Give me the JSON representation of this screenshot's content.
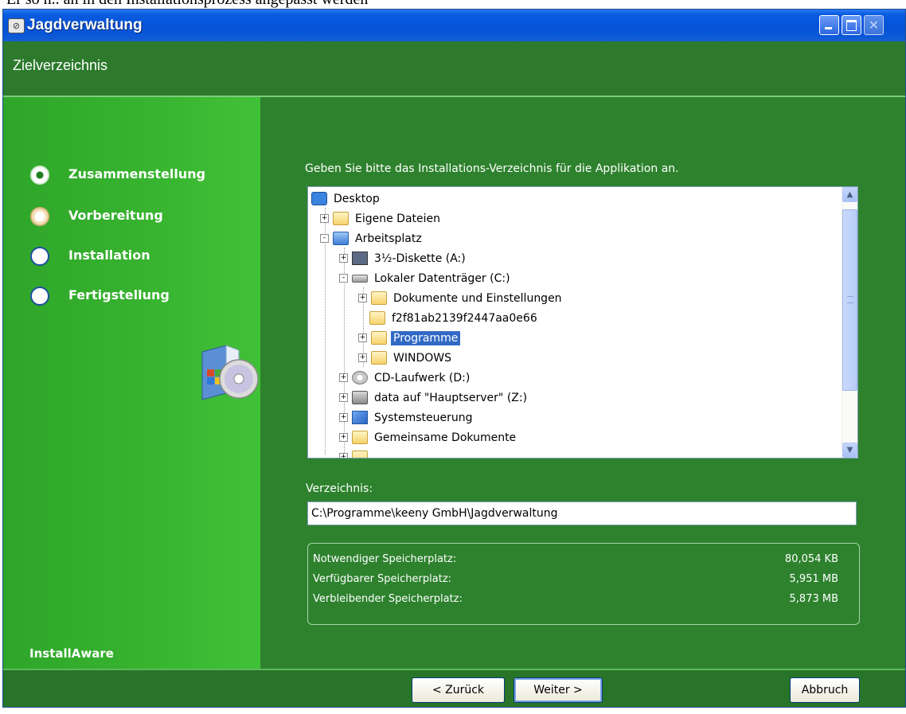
{
  "clipped_text": "Er so h.. an in den Installationsprozess angepasst werden",
  "window": {
    "title": "Jagdverwaltung",
    "buttons": {
      "minimize": "minimize",
      "maximize": "maximize",
      "close": "close"
    }
  },
  "header": {
    "title": "Zielverzeichnis"
  },
  "steps": [
    {
      "label": "Zusammenstellung",
      "state": "active"
    },
    {
      "label": "Vorbereitung",
      "state": "pending"
    },
    {
      "label": "Installation",
      "state": "pending"
    },
    {
      "label": "Fertigstellung",
      "state": "pending"
    }
  ],
  "brand": "InstallAware",
  "main": {
    "prompt": "Geben Sie bitte das Installations-Verzeichnis für die Applikation an.",
    "tree": [
      {
        "label": "Desktop",
        "icon": "desktop-icon",
        "level": 0,
        "expander": ""
      },
      {
        "label": "Eigene Dateien",
        "icon": "folder-icon",
        "level": 1,
        "expander": "+"
      },
      {
        "label": "Arbeitsplatz",
        "icon": "computer-icon",
        "level": 1,
        "expander": "-"
      },
      {
        "label": "3½-Diskette (A:)",
        "icon": "floppy-icon",
        "level": 2,
        "expander": "+"
      },
      {
        "label": "Lokaler Datenträger (C:)",
        "icon": "harddisk-icon",
        "level": 2,
        "expander": "-"
      },
      {
        "label": "Dokumente und Einstellungen",
        "icon": "folder-icon",
        "level": 3,
        "expander": "+"
      },
      {
        "label": "f2f81ab2139f2447aa0e66",
        "icon": "folder-icon",
        "level": 3,
        "expander": ""
      },
      {
        "label": "Programme",
        "icon": "folder-icon",
        "level": 3,
        "expander": "+",
        "selected": true
      },
      {
        "label": "WINDOWS",
        "icon": "folder-icon",
        "level": 3,
        "expander": "+"
      },
      {
        "label": "CD-Laufwerk (D:)",
        "icon": "cdrom-icon",
        "level": 2,
        "expander": "+"
      },
      {
        "label": "data auf \"Hauptserver\" (Z:)",
        "icon": "network-drive-icon",
        "level": 2,
        "expander": "+"
      },
      {
        "label": "Systemsteuerung",
        "icon": "control-panel-icon",
        "level": 2,
        "expander": "+"
      },
      {
        "label": "Gemeinsame Dokumente",
        "icon": "folder-icon",
        "level": 2,
        "expander": "+"
      }
    ],
    "directory_label": "Verzeichnis:",
    "directory_value": "C:\\Programme\\keeny GmbH\\Jagdverwaltung",
    "space": [
      {
        "label": "Notwendiger Speicherplatz:",
        "value": "80,054 KB"
      },
      {
        "label": "Verfügbarer Speicherplatz:",
        "value": "5,951 MB"
      },
      {
        "label": "Verbleibender Speicherplatz:",
        "value": "5,873 MB"
      }
    ]
  },
  "footer": {
    "back_label": "< Zurück",
    "next_label": "Weiter >",
    "cancel_label": "Abbruch"
  },
  "colors": {
    "title_bar": "#0752d8",
    "panel_green": "#2e822e",
    "sidebar_green": "#37b32f",
    "selection": "#316ac5"
  }
}
